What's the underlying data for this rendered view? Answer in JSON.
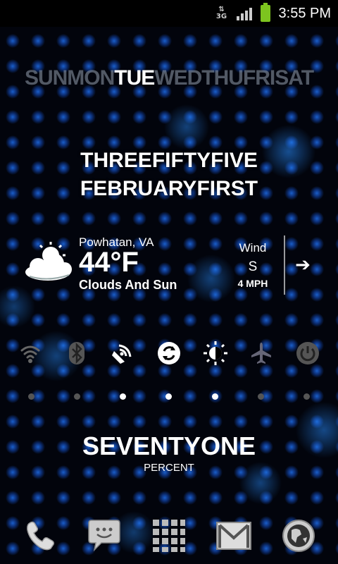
{
  "status_bar": {
    "network_type": "3G",
    "time": "3:55 PM",
    "icons": [
      "data-arrows-icon",
      "signal-icon",
      "battery-icon"
    ]
  },
  "days": [
    {
      "label": "SUN",
      "active": false
    },
    {
      "label": "MON",
      "active": false
    },
    {
      "label": "TUE",
      "active": true
    },
    {
      "label": "WED",
      "active": false
    },
    {
      "label": "THU",
      "active": false
    },
    {
      "label": "FRI",
      "active": false
    },
    {
      "label": "SAT",
      "active": false
    }
  ],
  "clock_widget": {
    "time_text_a": "THREE",
    "time_text_b": "FIFTY",
    "time_text_c": "FIVE",
    "date_text_a": "FEBRUARY",
    "date_text_b": "FIRST"
  },
  "weather": {
    "location": "Powhatan, VA",
    "temperature": "44°F",
    "condition": "Clouds And Sun",
    "wind_label": "Wind",
    "wind_direction": "S",
    "wind_speed": "4 MPH",
    "icon": "partly-cloudy-icon"
  },
  "toggles": [
    {
      "name": "wifi-icon",
      "enabled": false
    },
    {
      "name": "bluetooth-icon",
      "enabled": false
    },
    {
      "name": "gps-icon",
      "enabled": true
    },
    {
      "name": "sync-icon",
      "enabled": true
    },
    {
      "name": "brightness-icon",
      "enabled": true
    },
    {
      "name": "airplane-icon",
      "enabled": false
    },
    {
      "name": "power-icon",
      "enabled": false
    }
  ],
  "battery_widget": {
    "value_text": "SEVENTYONE",
    "label": "PERCENT"
  },
  "dock": [
    "phone-icon",
    "messaging-icon",
    "app-drawer-icon",
    "gmail-icon",
    "browser-icon"
  ],
  "colors": {
    "background": "#02040c",
    "dot_glow": "#1e6eeb",
    "battery_green": "#7dc41f",
    "inactive_text": "#96a0af"
  }
}
